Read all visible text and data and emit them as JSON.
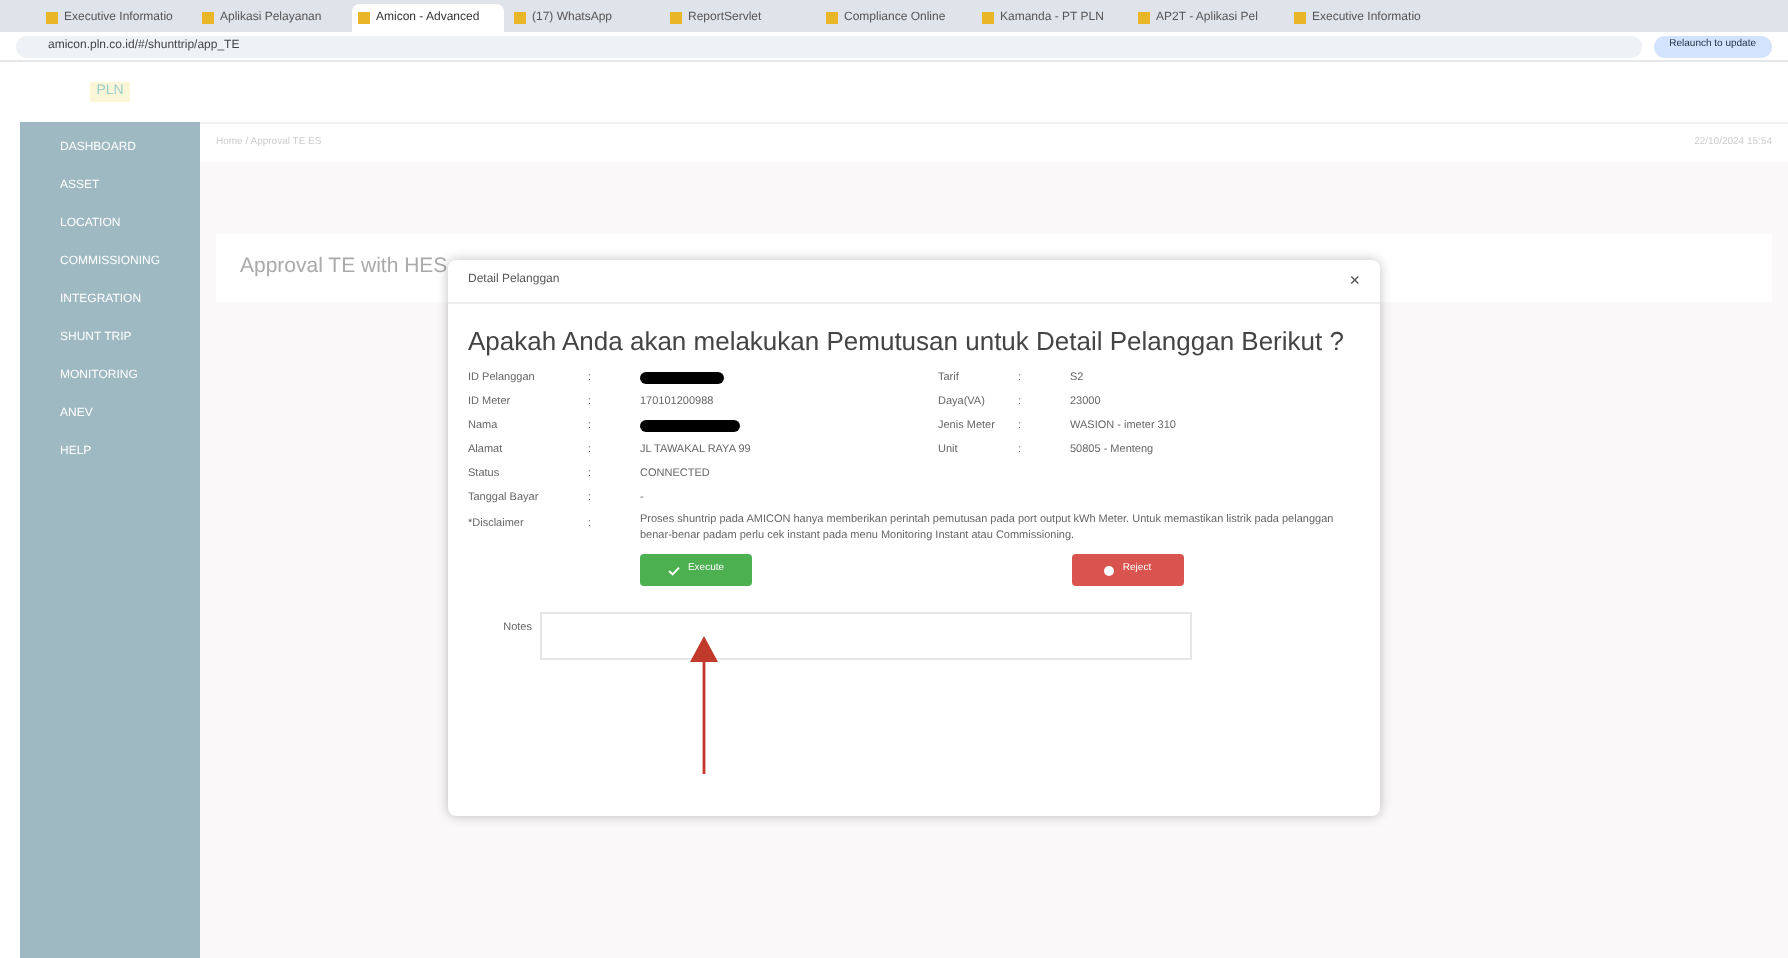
{
  "browser": {
    "tabs": [
      {
        "label": "Executive Informatio",
        "selected": false
      },
      {
        "label": "Aplikasi Pelayanan",
        "selected": false
      },
      {
        "label": "Amicon - Advanced",
        "selected": true
      },
      {
        "label": "(17) WhatsApp",
        "selected": false
      },
      {
        "label": "ReportServlet",
        "selected": false
      },
      {
        "label": "Compliance Online",
        "selected": false
      },
      {
        "label": "Kamanda - PT PLN",
        "selected": false
      },
      {
        "label": "AP2T - Aplikasi Pel",
        "selected": false
      },
      {
        "label": "Executive Informatio",
        "selected": false
      }
    ],
    "url": "amicon.pln.co.id/#/shunttrip/app_TE",
    "update_button": "Relaunch to update"
  },
  "sidebar": {
    "logo": "PLN",
    "items": [
      {
        "label": "DASHBOARD"
      },
      {
        "label": "ASSET"
      },
      {
        "label": "LOCATION"
      },
      {
        "label": "COMMISSIONING"
      },
      {
        "label": "INTEGRATION"
      },
      {
        "label": "SHUNT TRIP"
      },
      {
        "label": "MONITORING"
      },
      {
        "label": "ANEV"
      },
      {
        "label": "HELP"
      }
    ]
  },
  "page": {
    "breadcrumb": "Home / Approval TE ES",
    "datetime": "22/10/2024 15:54",
    "heading": "Approval TE with HES"
  },
  "dialog": {
    "title": "Detail Pelanggan",
    "close": "×",
    "question": "Apakah Anda akan melakukan Pemutusan untuk Detail Pelanggan Berikut ?",
    "left": [
      {
        "label": "ID Pelanggan",
        "kind": "redacted"
      },
      {
        "label": "ID Meter",
        "kind": "text",
        "value": "170101200988"
      },
      {
        "label": "Nama",
        "kind": "redacted"
      },
      {
        "label": "Alamat",
        "kind": "text",
        "value": "JL TAWAKAL RAYA 99"
      },
      {
        "label": "Status",
        "kind": "text",
        "value": "CONNECTED"
      },
      {
        "label": "Tanggal Bayar",
        "kind": "text",
        "value": "-"
      },
      {
        "label": "*Disclaimer",
        "kind": "text",
        "value": "Proses shuntrip pada AMICON hanya memberikan perintah pemutusan pada port output kWh Meter. Untuk memastikan listrik pada pelanggan benar-benar padam perlu cek instant pada menu Monitoring Instant atau Commissioning."
      }
    ],
    "right": [
      {
        "label": "Tarif",
        "value": "S2"
      },
      {
        "label": "Daya(VA)",
        "value": "23000"
      },
      {
        "label": "Jenis Meter",
        "value": "WASION - imeter 310"
      },
      {
        "label": "Unit",
        "value": "50805 - Menteng"
      }
    ],
    "separator": ":",
    "execute": "Execute",
    "reject": "Reject",
    "notes_label": "Notes"
  }
}
